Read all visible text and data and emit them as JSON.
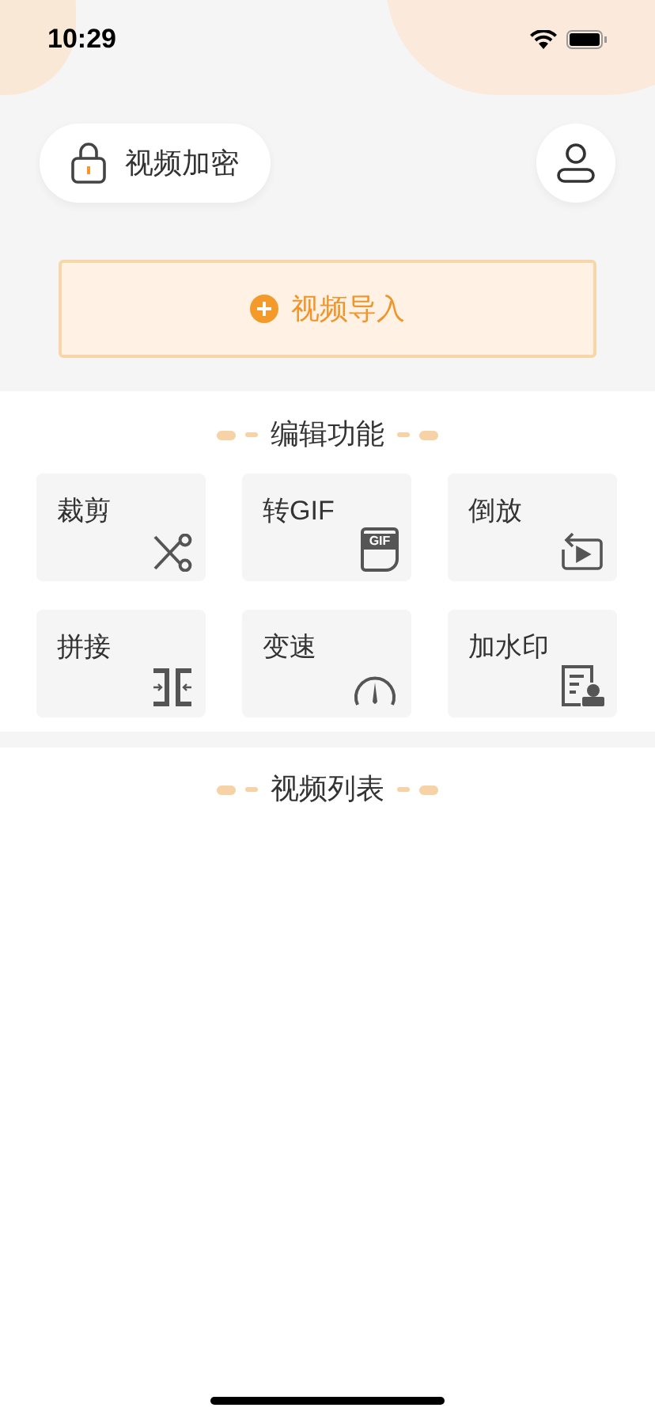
{
  "status_bar": {
    "time": "10:29"
  },
  "header": {
    "encrypt_button": "视频加密"
  },
  "import_button": {
    "label": "视频导入"
  },
  "edit_section": {
    "title": "编辑功能",
    "tools": [
      {
        "label": "裁剪",
        "kind": "scissors"
      },
      {
        "label": "转GIF",
        "kind": "gif",
        "icon_text": "GIF"
      },
      {
        "label": "倒放",
        "kind": "reverse"
      },
      {
        "label": "拼接",
        "kind": "join"
      },
      {
        "label": "变速",
        "kind": "speed"
      },
      {
        "label": "加水印",
        "kind": "watermark"
      }
    ]
  },
  "video_list": {
    "title": "视频列表"
  }
}
